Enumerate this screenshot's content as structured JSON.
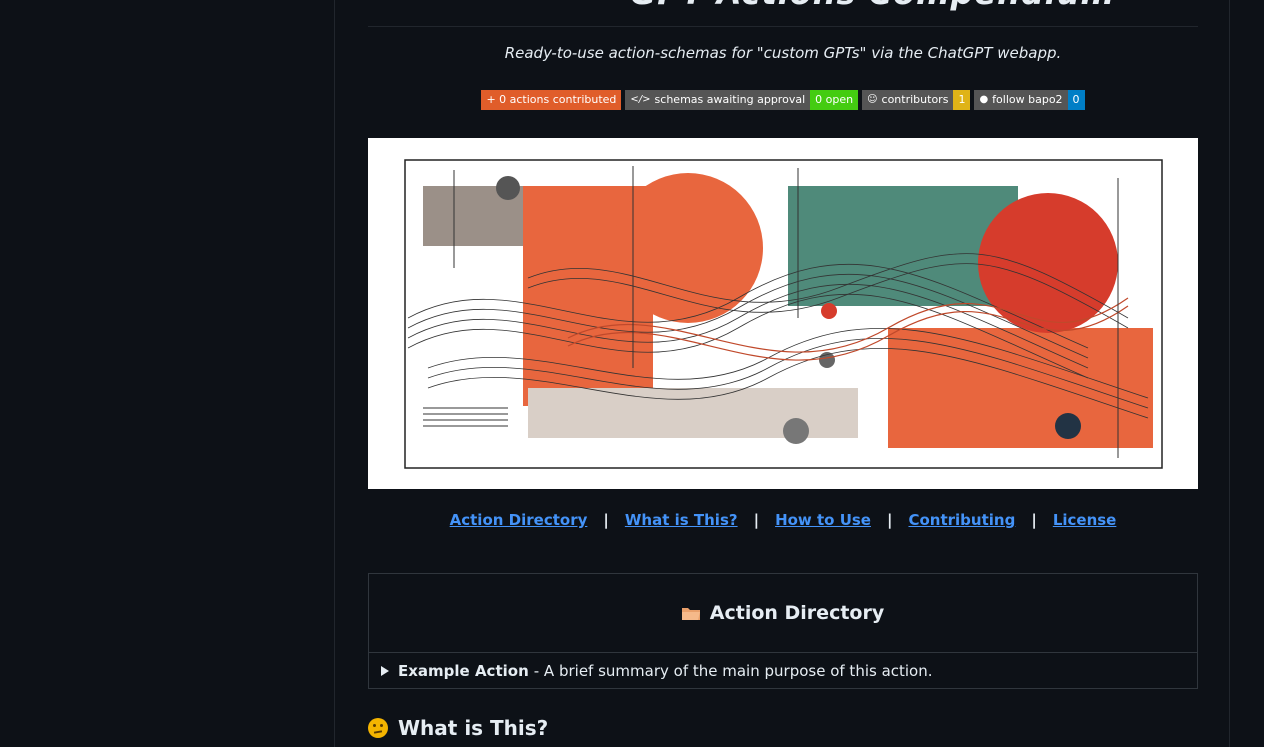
{
  "header": {
    "title": "GPT Actions Compendium",
    "tagline": "Ready-to-use action-schemas for \"custom GPTs\" via the ChatGPT webapp."
  },
  "badges": [
    {
      "left": "+  0 actions contributed",
      "color": "#e05d2a"
    },
    {
      "left": "schemas awaiting approval",
      "right": "0 open",
      "right_color": "#44cc11"
    },
    {
      "left": "contributors",
      "right": "1",
      "right_color": "#dfb317"
    },
    {
      "left": "follow bapo2",
      "right": "0",
      "right_color": "#007ec6"
    }
  ],
  "nav": {
    "links": [
      "Action Directory",
      "What is This?",
      "How to Use",
      "Contributing",
      "License"
    ],
    "separator": "|"
  },
  "directory": {
    "heading": "Action Directory",
    "heading_icon": "folder-icon",
    "items": [
      {
        "name": "Example Action",
        "summary": "- A brief summary of the main purpose of this action."
      }
    ]
  },
  "section": {
    "heading": "What is This?",
    "heading_icon": "thinking-face-icon"
  },
  "colors": {
    "background": "#0d1117",
    "link": "#4493f8",
    "border": "#30363d"
  }
}
